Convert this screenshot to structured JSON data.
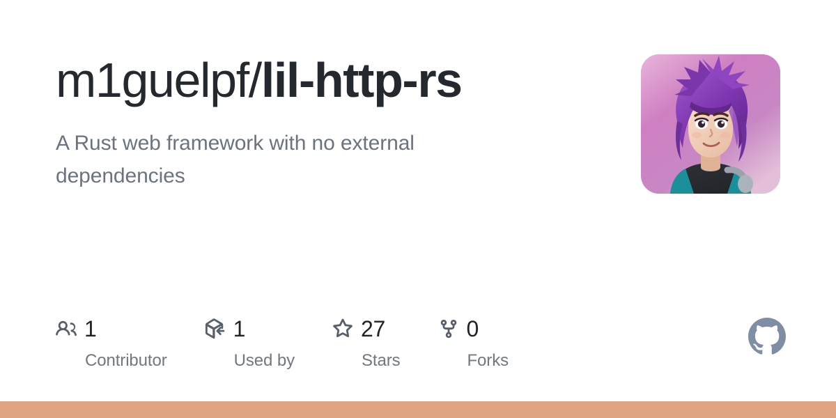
{
  "repository": {
    "owner": "m1guelpf",
    "separator": "/",
    "name": "lil-http-rs",
    "description": "A Rust web framework with no external dependencies"
  },
  "avatar": {
    "alt": "m1guelpf avatar",
    "icon": "user-avatar-illustration"
  },
  "stats": [
    {
      "icon": "people-icon",
      "value": "1",
      "label": "Contributor"
    },
    {
      "icon": "package-dependents-icon",
      "value": "1",
      "label": "Used by"
    },
    {
      "icon": "star-icon",
      "value": "27",
      "label": "Stars"
    },
    {
      "icon": "repo-forked-icon",
      "value": "0",
      "label": "Forks"
    }
  ],
  "brand": {
    "logo": "github-mark-icon"
  },
  "colors": {
    "background": "#ffffff",
    "title": "#24292f",
    "description": "#6b7280",
    "stat_value": "#1f2328",
    "stat_label": "#72787f",
    "icon": "#57606a",
    "github_logo": "#7f8da5",
    "accent_bar": "#dfa583"
  }
}
